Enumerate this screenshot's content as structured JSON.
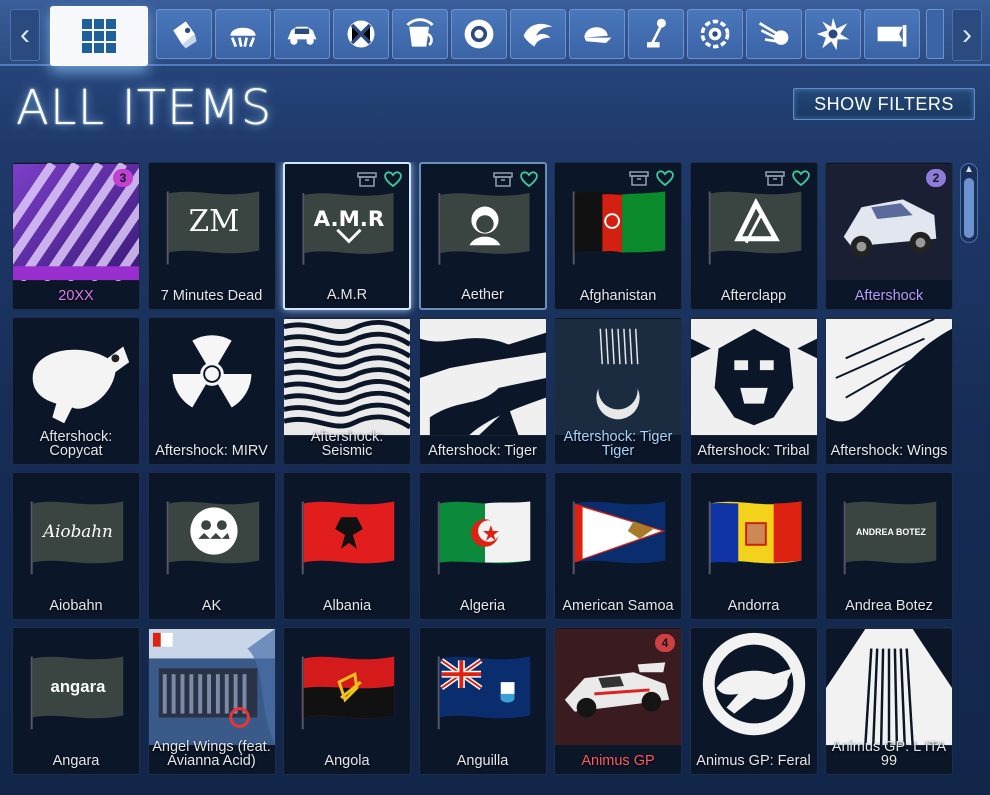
{
  "tabs": [
    {
      "name": "all-items",
      "icon": "grid-icon",
      "active": true
    },
    {
      "name": "decals",
      "icon": "decal-icon"
    },
    {
      "name": "toppers",
      "icon": "topper-icon"
    },
    {
      "name": "bodies",
      "icon": "car-body-icon"
    },
    {
      "name": "paint-finishes",
      "icon": "paint-finish-icon"
    },
    {
      "name": "paints",
      "icon": "paint-bucket-icon"
    },
    {
      "name": "wheels",
      "icon": "wheel-icon"
    },
    {
      "name": "boosts",
      "icon": "boost-icon"
    },
    {
      "name": "hats",
      "icon": "cap-icon"
    },
    {
      "name": "antennas",
      "icon": "antenna-icon"
    },
    {
      "name": "engine-audio",
      "icon": "engine-icon"
    },
    {
      "name": "trails",
      "icon": "trail-icon"
    },
    {
      "name": "goal-explosions",
      "icon": "explosion-icon"
    },
    {
      "name": "banners",
      "icon": "banner-icon"
    }
  ],
  "header": {
    "title": "ALL ITEMS",
    "show_filters": "SHOW FILTERS"
  },
  "items": [
    {
      "label": "20XX",
      "kind": "stripes",
      "label_color": "#e07af0",
      "badge": "3",
      "badge_color": "#c040d0"
    },
    {
      "label": "7 Minutes Dead",
      "kind": "flag-logo",
      "logo": "ZM"
    },
    {
      "label": "A.M.R",
      "kind": "flag-logo",
      "logo": "AMR",
      "selected": true,
      "icons": true
    },
    {
      "label": "Aether",
      "kind": "flag-logo",
      "logo": "face",
      "selected2": true,
      "icons": true
    },
    {
      "label": "Afghanistan",
      "kind": "flag-afghanistan",
      "icons": true
    },
    {
      "label": "Afterclapp",
      "kind": "flag-logo",
      "logo": "tri",
      "icons": true
    },
    {
      "label": "Aftershock",
      "kind": "car",
      "label_color": "#b79cff",
      "badge": "2",
      "badge_color": "#8e7cd8"
    },
    {
      "label": "Aftershock: Copycat",
      "kind": "decal-cat"
    },
    {
      "label": "Aftershock: MIRV",
      "kind": "decal-radiation"
    },
    {
      "label": "Aftershock: Seismic",
      "kind": "decal-seismic"
    },
    {
      "label": "Aftershock: Tiger",
      "kind": "decal-tiger"
    },
    {
      "label": "Aftershock: Tiger Tiger",
      "kind": "decal-moon",
      "label_color": "#a8d4ff"
    },
    {
      "label": "Aftershock: Tribal",
      "kind": "decal-tribal"
    },
    {
      "label": "Aftershock: Wings",
      "kind": "decal-wings"
    },
    {
      "label": "Aiobahn",
      "kind": "flag-logo",
      "logo": "Aiobahn"
    },
    {
      "label": "AK",
      "kind": "flag-logo",
      "logo": "ak"
    },
    {
      "label": "Albania",
      "kind": "flag-albania"
    },
    {
      "label": "Algeria",
      "kind": "flag-algeria"
    },
    {
      "label": "American Samoa",
      "kind": "flag-samoa"
    },
    {
      "label": "Andorra",
      "kind": "flag-andorra"
    },
    {
      "label": "Andrea Botez",
      "kind": "flag-logo",
      "logo": "ANDREA BOTEZ"
    },
    {
      "label": "Angara",
      "kind": "flag-logo",
      "logo": "angara"
    },
    {
      "label": "Angel Wings (feat. Avianna Acid)",
      "kind": "album"
    },
    {
      "label": "Angola",
      "kind": "flag-angola"
    },
    {
      "label": "Anguilla",
      "kind": "flag-anguilla"
    },
    {
      "label": "Animus GP",
      "kind": "car-f1",
      "label_color": "#ff5a5a",
      "badge": "4",
      "badge_color": "#d04040"
    },
    {
      "label": "Animus GP: Feral",
      "kind": "decal-panther"
    },
    {
      "label": "Animus GP: L ITA 99",
      "kind": "decal-lita"
    }
  ]
}
